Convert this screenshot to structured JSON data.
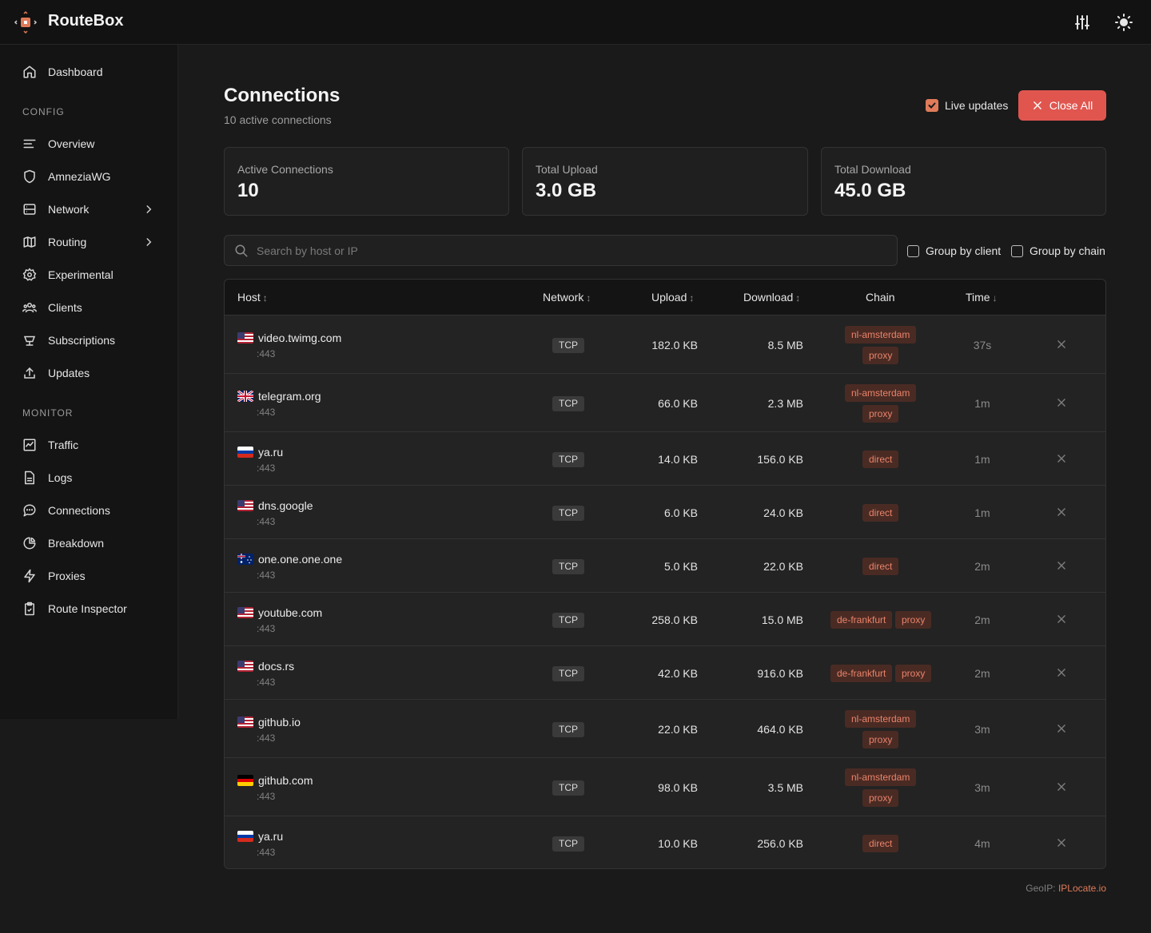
{
  "header": {
    "brand": "RouteBox",
    "icons": [
      "settings-sliders-icon",
      "sun-icon"
    ]
  },
  "sidebar": {
    "dashboard": "Dashboard",
    "config_label": "CONFIG",
    "config_items": [
      {
        "label": "Overview",
        "icon": "lines-icon"
      },
      {
        "label": "AmneziaWG",
        "icon": "shield-icon"
      },
      {
        "label": "Network",
        "icon": "server-icon",
        "has_submenu": true
      },
      {
        "label": "Routing",
        "icon": "map-icon",
        "has_submenu": true
      },
      {
        "label": "Experimental",
        "icon": "gear-icon"
      },
      {
        "label": "Clients",
        "icon": "users-icon"
      },
      {
        "label": "Subscriptions",
        "icon": "cup-icon"
      },
      {
        "label": "Updates",
        "icon": "upload-icon"
      }
    ],
    "monitor_label": "MONITOR",
    "monitor_items": [
      {
        "label": "Traffic",
        "icon": "chart-icon"
      },
      {
        "label": "Logs",
        "icon": "file-icon"
      },
      {
        "label": "Connections",
        "icon": "chat-icon"
      },
      {
        "label": "Breakdown",
        "icon": "pie-icon"
      },
      {
        "label": "Proxies",
        "icon": "bolt-icon"
      },
      {
        "label": "Route Inspector",
        "icon": "clipboard-check-icon"
      }
    ]
  },
  "main": {
    "title": "Connections",
    "subtitle": "10 active connections",
    "live_updates": {
      "label": "Live updates",
      "checked": true
    },
    "close_all": "Close All",
    "stats": [
      {
        "label": "Active Connections",
        "value": "10"
      },
      {
        "label": "Total Upload",
        "value": "3.0 GB"
      },
      {
        "label": "Total Download",
        "value": "45.0 GB"
      }
    ],
    "search_placeholder": "Search by host or IP",
    "group_by_client": "Group by client",
    "group_by_chain": "Group by chain",
    "columns": {
      "host": "Host",
      "network": "Network",
      "upload": "Upload",
      "download": "Download",
      "chain": "Chain",
      "time": "Time"
    },
    "rows": [
      {
        "flag": "us",
        "host": "video.twimg.com",
        "port": ":443",
        "network": "TCP",
        "upload": "182.0 KB",
        "download": "8.5 MB",
        "chain": [
          "nl-amsterdam",
          "proxy"
        ],
        "time": "37s"
      },
      {
        "flag": "gb",
        "host": "telegram.org",
        "port": ":443",
        "network": "TCP",
        "upload": "66.0 KB",
        "download": "2.3 MB",
        "chain": [
          "nl-amsterdam",
          "proxy"
        ],
        "time": "1m"
      },
      {
        "flag": "ru",
        "host": "ya.ru",
        "port": ":443",
        "network": "TCP",
        "upload": "14.0 KB",
        "download": "156.0 KB",
        "chain": [
          "direct"
        ],
        "time": "1m"
      },
      {
        "flag": "us",
        "host": "dns.google",
        "port": ":443",
        "network": "TCP",
        "upload": "6.0 KB",
        "download": "24.0 KB",
        "chain": [
          "direct"
        ],
        "time": "1m"
      },
      {
        "flag": "au",
        "host": "one.one.one.one",
        "port": ":443",
        "network": "TCP",
        "upload": "5.0 KB",
        "download": "22.0 KB",
        "chain": [
          "direct"
        ],
        "time": "2m"
      },
      {
        "flag": "us",
        "host": "youtube.com",
        "port": ":443",
        "network": "TCP",
        "upload": "258.0 KB",
        "download": "15.0 MB",
        "chain": [
          "de-frankfurt",
          "proxy"
        ],
        "time": "2m"
      },
      {
        "flag": "us",
        "host": "docs.rs",
        "port": ":443",
        "network": "TCP",
        "upload": "42.0 KB",
        "download": "916.0 KB",
        "chain": [
          "de-frankfurt",
          "proxy"
        ],
        "time": "2m"
      },
      {
        "flag": "us",
        "host": "github.io",
        "port": ":443",
        "network": "TCP",
        "upload": "22.0 KB",
        "download": "464.0 KB",
        "chain": [
          "nl-amsterdam",
          "proxy"
        ],
        "time": "3m"
      },
      {
        "flag": "de",
        "host": "github.com",
        "port": ":443",
        "network": "TCP",
        "upload": "98.0 KB",
        "download": "3.5 MB",
        "chain": [
          "nl-amsterdam",
          "proxy"
        ],
        "time": "3m"
      },
      {
        "flag": "ru",
        "host": "ya.ru",
        "port": ":443",
        "network": "TCP",
        "upload": "10.0 KB",
        "download": "256.0 KB",
        "chain": [
          "direct"
        ],
        "time": "4m"
      }
    ],
    "geoip_label": "GeoIP:",
    "geoip_link": "IPLocate.io"
  }
}
